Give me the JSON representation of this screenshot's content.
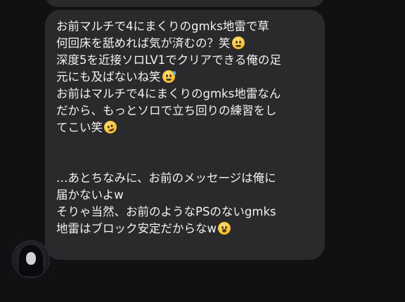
{
  "message": {
    "lines": [
      "お前マルチで4にまくりのgmks地雷で草",
      "何回床を舐めれば気が済むの？笑",
      "深度5を近接ソロLV1でクリアできる俺の足",
      "元にも及ばないね笑",
      "お前はマルチで4にまくりのgmks地雷なん",
      "だから、もっとソロで立ち回りの練習をし",
      "てこい笑",
      "",
      "",
      "…あとちなみに、お前のメッセージは俺に",
      "届かないよw",
      "そりゃ当然、お前のようなPSのないgmks",
      "地雷はブロック安定だからなw"
    ],
    "emojis": {
      "line_2": "pleading-face-emoji",
      "line_4": "grinning-sweat-emoji",
      "line_7": "rolling-laughing-emoji",
      "line_13": "yawning-face-emoji"
    }
  },
  "colors": {
    "background": "#111113",
    "bubble": "#2a2a2d",
    "text": "#f2f2f4"
  }
}
